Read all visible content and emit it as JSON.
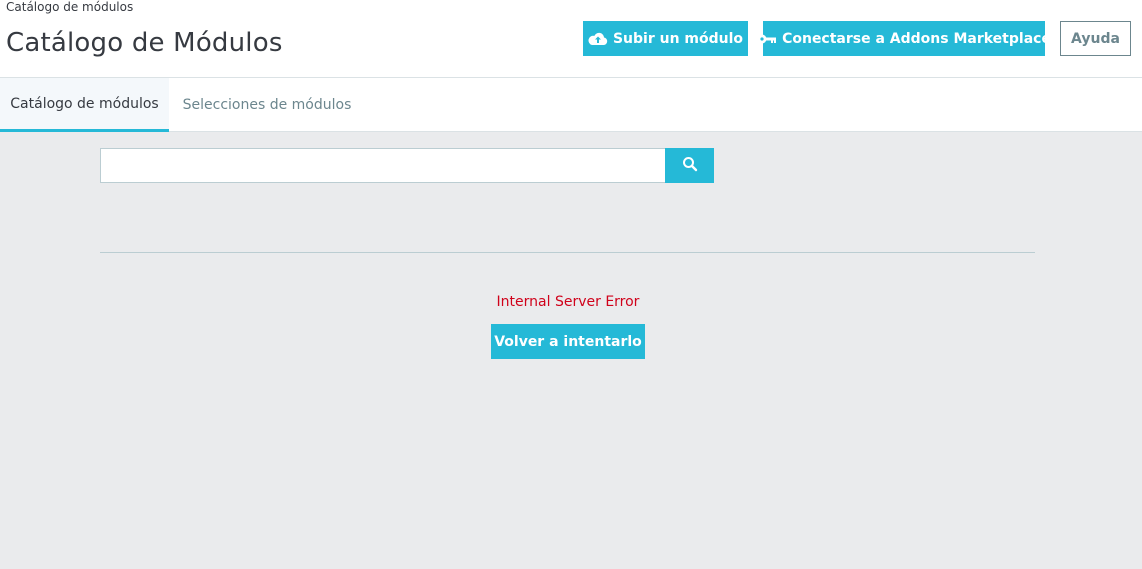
{
  "header": {
    "breadcrumb": "Catálogo de módulos",
    "title": "Catálogo de Módulos",
    "buttons": {
      "upload": {
        "label": "Subir un módulo",
        "icon": "cloud-upload-icon"
      },
      "connect": {
        "label": "Conectarse a Addons Marketplace",
        "icon": "key-icon"
      },
      "help": {
        "label": "Ayuda"
      }
    }
  },
  "tabs": [
    {
      "label": "Catálogo de módulos",
      "active": true
    },
    {
      "label": "Selecciones de módulos",
      "active": false
    }
  ],
  "search": {
    "value": "",
    "placeholder": "",
    "button_icon": "search-icon"
  },
  "error": {
    "message": "Internal Server Error",
    "retry_label": "Volver a intentarlo"
  },
  "colors": {
    "primary": "#25b9d7",
    "error": "#d0021b",
    "background": "#eaebed"
  }
}
